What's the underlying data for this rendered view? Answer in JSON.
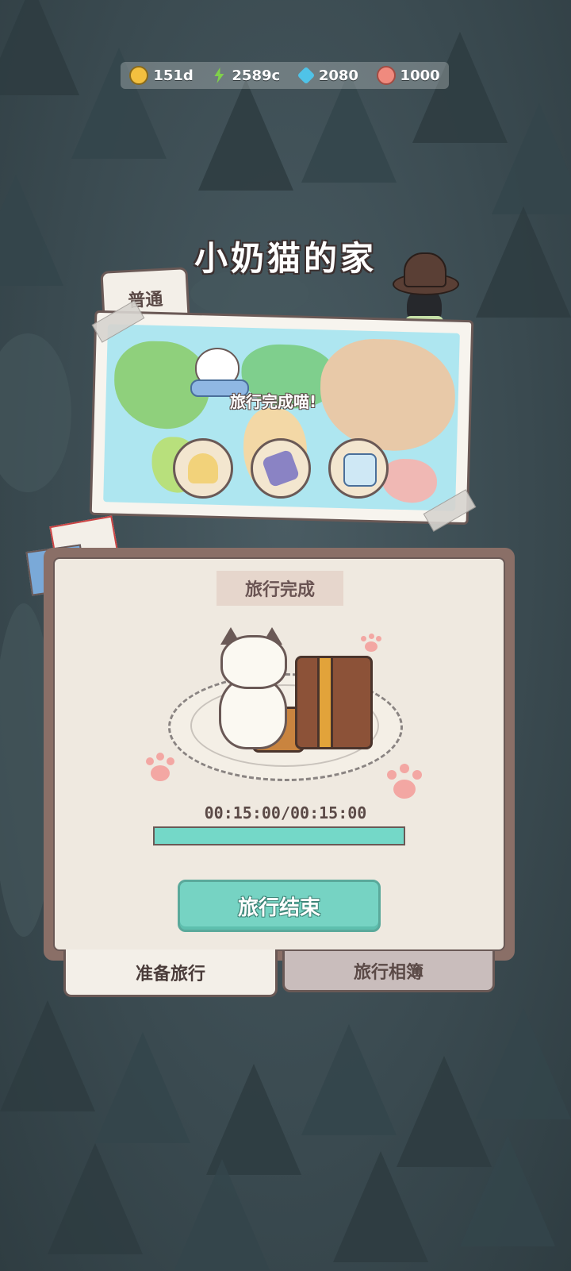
{
  "currencies": [
    {
      "icon": "gold-coin-icon",
      "value": "151d",
      "color": "#f3c03f"
    },
    {
      "icon": "lightning-energy-icon",
      "value": "2589c",
      "color": "#7fd04b"
    },
    {
      "icon": "blue-gem-icon",
      "value": "2080",
      "color": "#4fc3e8"
    },
    {
      "icon": "pink-shell-icon",
      "value": "1000",
      "color": "#f08a7e"
    }
  ],
  "home_title": "小奶猫的家",
  "map_tab": "普通",
  "map_message": "旅行完成喵!",
  "travel_items": [
    {
      "icon": "yellow-hat-icon"
    },
    {
      "icon": "purple-power-adapter-icon"
    },
    {
      "icon": "jet-ticket-icon"
    }
  ],
  "status_label": "旅行完成",
  "timer": {
    "elapsed": "00:15:00",
    "total": "00:15:00",
    "separator": "/",
    "progress": 1.0
  },
  "end_button": "旅行结束",
  "bottom_tabs": {
    "prepare": "准备旅行",
    "album": "旅行相簿"
  },
  "colors": {
    "accent": "#76d3c3",
    "panel_border": "#6a5956",
    "background": "#3c4c52"
  }
}
